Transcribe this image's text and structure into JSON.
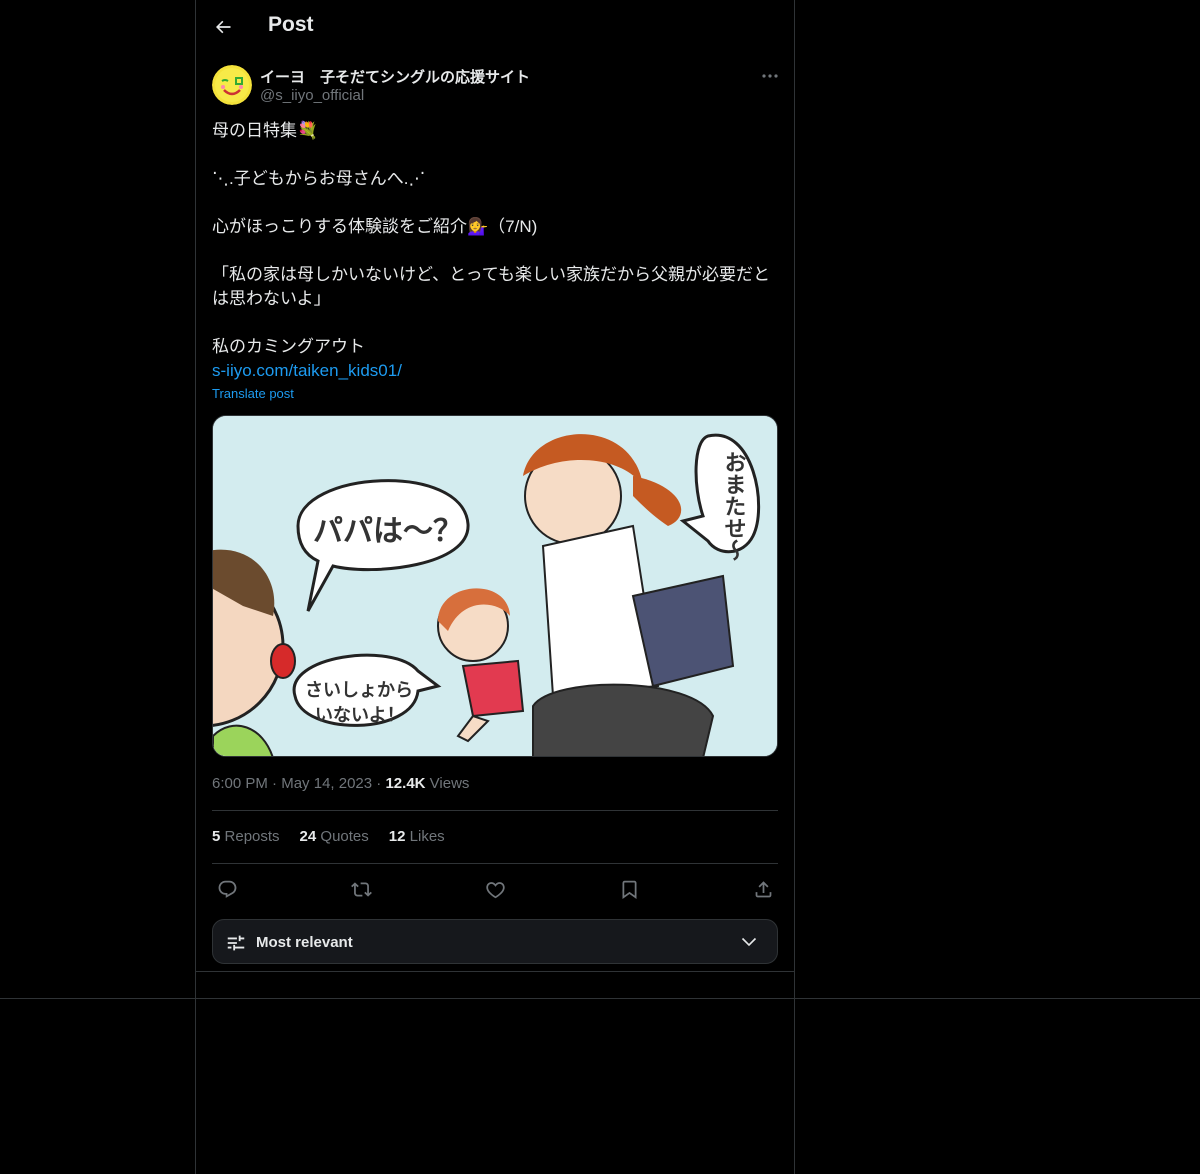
{
  "header": {
    "title": "Post"
  },
  "author": {
    "name": "イーヨ　子そだてシングルの応援サイト",
    "handle": "@s_iiyo_official"
  },
  "post": {
    "lines": [
      "母の日特集💐",
      "",
      "⋱.子どもからお母さんへ.⋰",
      "",
      "心がほっこりする体験談をご紹介💁‍♀️（7/N)",
      "",
      "「私の家は母しかいないけど、とっても楽しい家族だから父親が必要だとは思わないよ」",
      "",
      "私のカミングアウト"
    ],
    "link": "s-iiyo.com/taiken_kids01/",
    "translate": "Translate post"
  },
  "media": {
    "bubble_1": "パパは〜？",
    "bubble_2_line1": "さいしょから",
    "bubble_2_line2": "いないよ！",
    "bubble_3": "おまたせ〜"
  },
  "meta": {
    "time": "6:00 PM",
    "dot": "·",
    "date": "May 14, 2023",
    "views_count": "12.4K",
    "views_label": "Views"
  },
  "stats": [
    {
      "count": "5",
      "label": "Reposts"
    },
    {
      "count": "24",
      "label": "Quotes"
    },
    {
      "count": "12",
      "label": "Likes"
    }
  ],
  "sort": {
    "label": "Most relevant"
  },
  "colors": {
    "background": "#000000",
    "link": "#1d9bf0",
    "muted": "#71767b",
    "border": "#2f3336"
  }
}
